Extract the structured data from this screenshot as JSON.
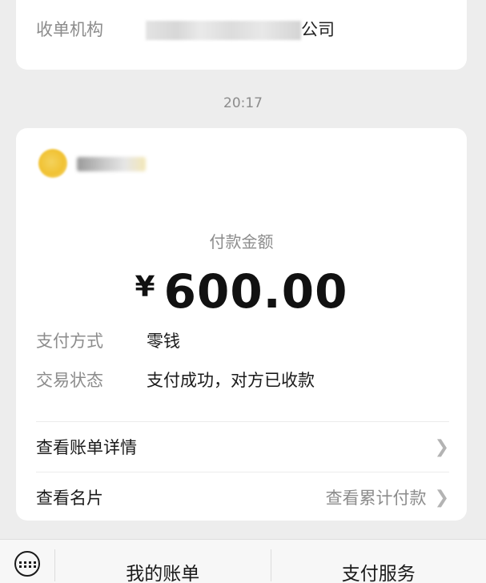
{
  "receipt": {
    "institution_label": "收单机构",
    "institution_value_visible": "司",
    "institution_value_tail": "公司"
  },
  "time": "20:17",
  "payment": {
    "amount_label": "付款金额",
    "currency": "¥",
    "amount": "600.00",
    "method_label": "支付方式",
    "method_value": "零钱",
    "status_label": "交易状态",
    "status_value": "支付成功，对方已收款"
  },
  "links": {
    "bill_detail": "查看账单详情",
    "business_card": "查看名片",
    "cumulative": "查看累计付款"
  },
  "bottom_menu": {
    "my_bill": "我的账单",
    "pay_service": "支付服务"
  },
  "icons": {
    "chevron": "chevron-right-icon",
    "keyboard": "keyboard-icon"
  },
  "colors": {
    "background": "#ededed",
    "card": "#ffffff",
    "secondary_text": "#8c8c8c"
  }
}
